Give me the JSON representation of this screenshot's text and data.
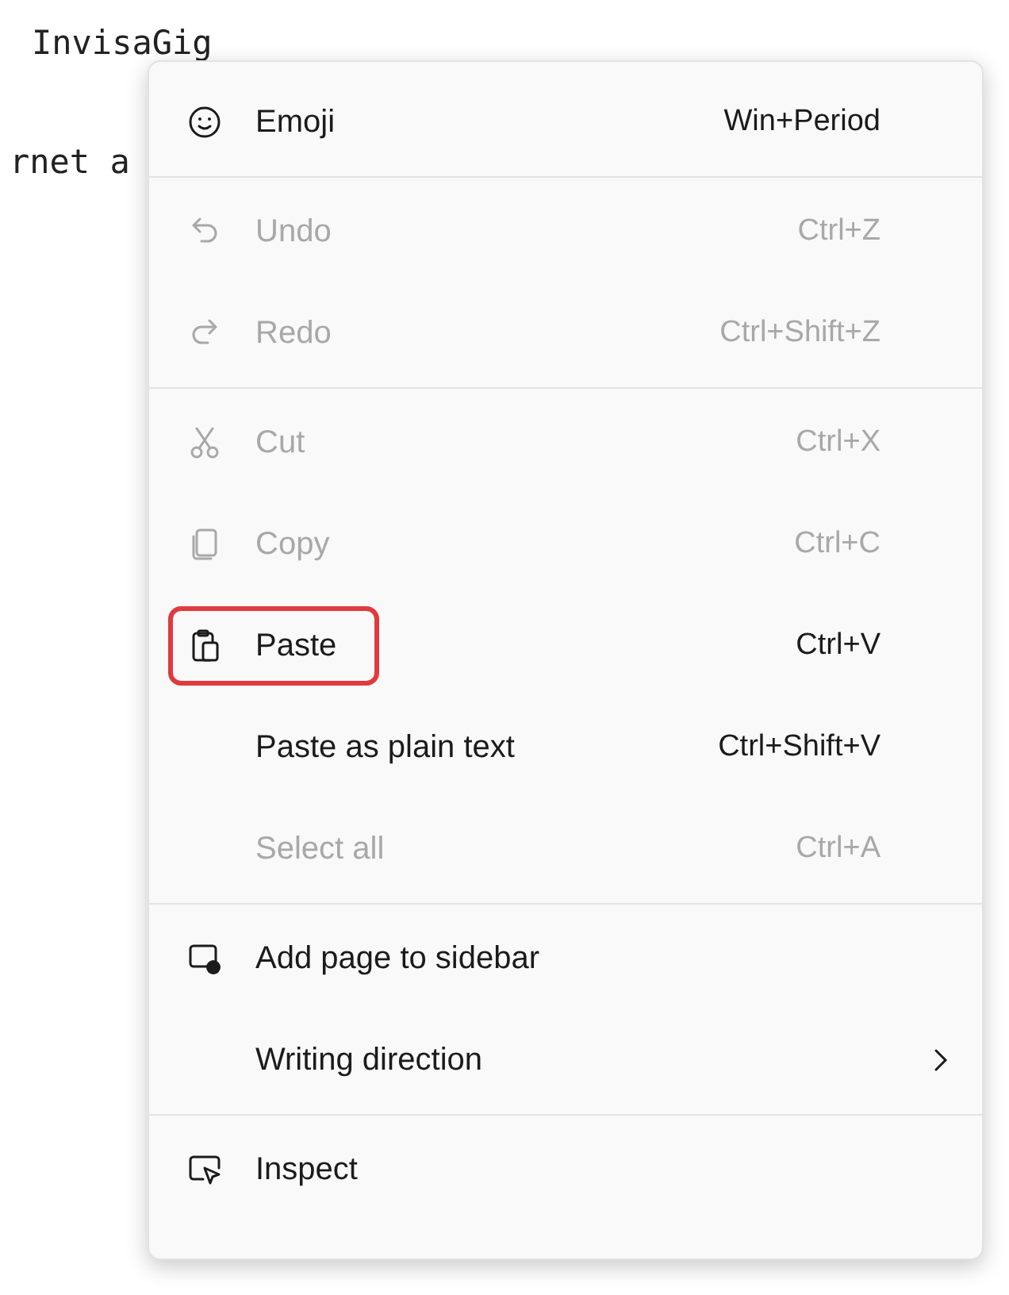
{
  "page_lines": [
    "InvisaGig",
    "rnet a"
  ],
  "menu": {
    "groups": [
      [
        {
          "label": "Emoji",
          "shortcut": "Win+Period",
          "disabled": false,
          "outlined": false,
          "submenu": false
        }
      ],
      [
        {
          "label": "Undo",
          "shortcut": "Ctrl+Z",
          "disabled": true,
          "outlined": false,
          "submenu": false
        },
        {
          "label": "Redo",
          "shortcut": "Ctrl+Shift+Z",
          "disabled": true,
          "outlined": false,
          "submenu": false
        }
      ],
      [
        {
          "label": "Cut",
          "shortcut": "Ctrl+X",
          "disabled": true,
          "outlined": false,
          "submenu": false
        },
        {
          "label": "Copy",
          "shortcut": "Ctrl+C",
          "disabled": true,
          "outlined": false,
          "submenu": false
        },
        {
          "label": "Paste",
          "shortcut": "Ctrl+V",
          "disabled": false,
          "outlined": true,
          "submenu": false
        },
        {
          "label": "Paste as plain text",
          "shortcut": "Ctrl+Shift+V",
          "disabled": false,
          "outlined": false,
          "submenu": false
        },
        {
          "label": "Select all",
          "shortcut": "Ctrl+A",
          "disabled": true,
          "outlined": false,
          "submenu": false
        }
      ],
      [
        {
          "label": "Add page to sidebar",
          "disabled": false,
          "outlined": false,
          "submenu": false
        },
        {
          "label": "Writing direction",
          "disabled": false,
          "outlined": false,
          "submenu": true
        }
      ],
      [
        {
          "label": "Inspect",
          "disabled": false,
          "outlined": false,
          "submenu": false
        }
      ]
    ]
  }
}
